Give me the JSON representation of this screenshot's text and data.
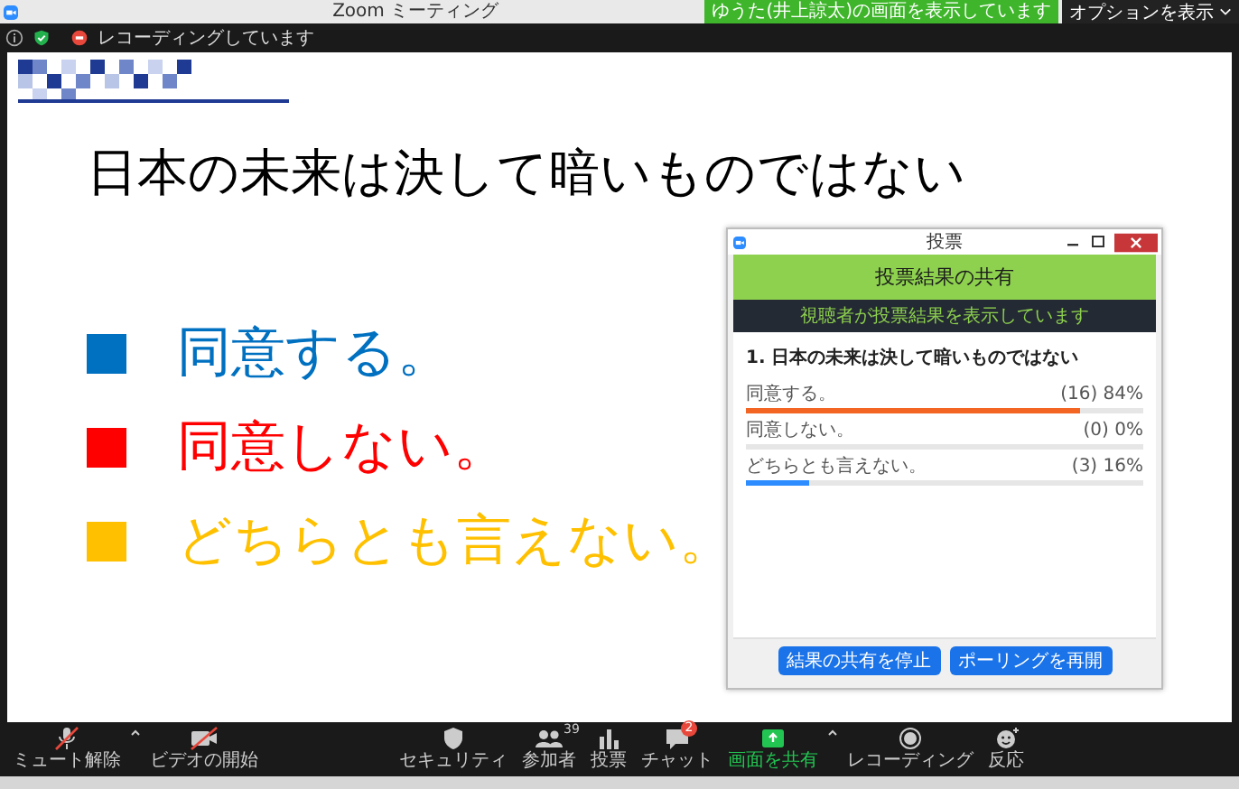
{
  "window": {
    "title": "Zoom ミーティング"
  },
  "share_notice": "ゆうた(井上諒太)の画面を表示しています",
  "view_options": "オプションを表示",
  "status": {
    "recording": "レコーディングしています"
  },
  "slide": {
    "title": "日本の未来は決して暗いものではない",
    "bullets": [
      {
        "text": "同意する。",
        "color": "#0070c0"
      },
      {
        "text": "同意しない。",
        "color": "#ff0000"
      },
      {
        "text": "どちらとも言えない。",
        "color": "#ffc000"
      }
    ]
  },
  "poll_window": {
    "title": "投票",
    "header": "投票結果の共有",
    "banner": "視聴者が投票結果を表示しています",
    "question": "1. 日本の未来は決して暗いものではない",
    "options": [
      {
        "label": "同意する。",
        "count": "(16) 84%",
        "level": 0.84,
        "color": "#f26522"
      },
      {
        "label": "同意しない。",
        "count": "(0) 0%"
      },
      {
        "label": "どちらとも言えない。",
        "count": "(3) 16%",
        "level": 0.16,
        "color": "#2d8cff"
      }
    ],
    "buttons": [
      "結果の共有を停止",
      "ポーリングを再開"
    ]
  },
  "toolbar": {
    "left": [
      {
        "kind": "mic_off",
        "label": "ミュート解除",
        "menu": true
      },
      {
        "kind": "video_off",
        "label": "ビデオの開始",
        "menu": false
      }
    ],
    "center": [
      {
        "kind": "security",
        "label": "セキュリティ",
        "menu": false
      },
      {
        "kind": "participants",
        "label": "参加者",
        "count": "39",
        "menu": false
      },
      {
        "kind": "polls",
        "label": "投票",
        "menu": false
      },
      {
        "kind": "chat",
        "label": "チャット",
        "badge": "2",
        "menu": false
      },
      {
        "kind": "share",
        "label": "画面を共有",
        "menu": true
      },
      {
        "kind": "record",
        "label": "レコーディング",
        "menu": false
      },
      {
        "kind": "reactions",
        "label": "反応",
        "menu": false
      }
    ]
  }
}
